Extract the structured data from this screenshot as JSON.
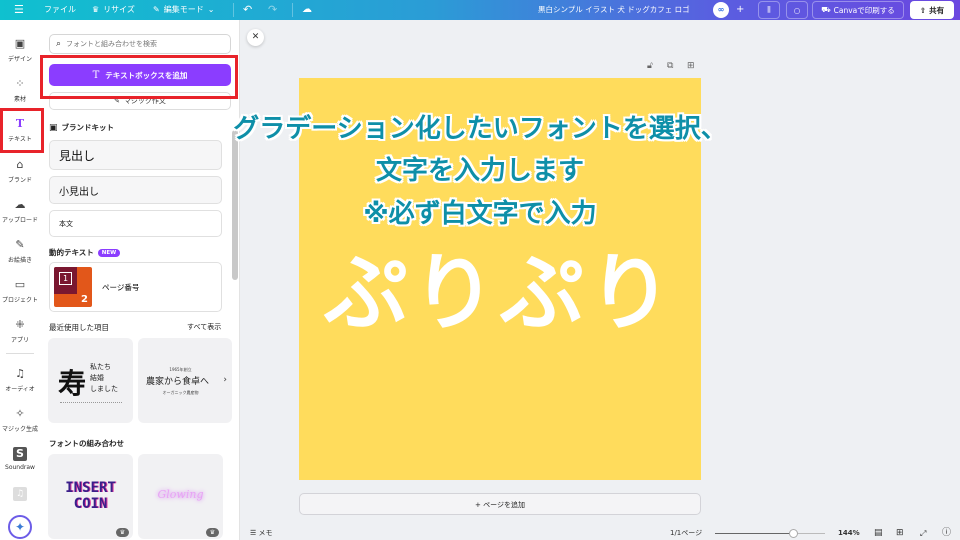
{
  "topbar": {
    "menu_icon": "hamburger-icon",
    "file": "ファイル",
    "resize": "リサイズ",
    "edit_mode": "編集モード",
    "undo_icon": "undo-icon",
    "redo_icon": "redo-icon",
    "cloud_icon": "cloud-saved-icon",
    "doc_title": "黒白シンプル イラスト 犬 ドッグカフェ ロゴ",
    "add": "+",
    "print": "Canvaで印刷する",
    "share": "共有"
  },
  "rail": {
    "items": [
      {
        "label": "デザイン",
        "icon": "▣"
      },
      {
        "label": "素材",
        "icon": "⁘"
      },
      {
        "label": "テキスト",
        "icon": "T"
      },
      {
        "label": "ブランド",
        "icon": "⌂"
      },
      {
        "label": "アップロード",
        "icon": "☁"
      },
      {
        "label": "お絵描き",
        "icon": "✎"
      },
      {
        "label": "プロジェクト",
        "icon": "▭"
      },
      {
        "label": "アプリ",
        "icon": "⁜"
      },
      {
        "label": "オーディオ",
        "icon": "♫"
      },
      {
        "label": "マジック生成",
        "icon": "✧"
      },
      {
        "label": "Soundraw",
        "icon": "S"
      }
    ]
  },
  "panel": {
    "search_placeholder": "フォントと組み合わせを検索",
    "add_textbox": "テキストボックスを追加",
    "magic_write": "マジック作文",
    "brand_kit": "ブランドキット",
    "heading": "見出し",
    "subheading": "小見出し",
    "body": "本文",
    "dynamic_text": "動的テキスト",
    "new_badge": "NEW",
    "page_number": "ページ番号",
    "thumb_num1": "1",
    "thumb_num2": "2",
    "recent": "最近使用した項目",
    "see_all": "すべて表示",
    "recent_items": [
      {
        "big": "寿",
        "lines": "私たち\n結婚\nしました"
      },
      {
        "small_top": "1965年創立",
        "big": "農家から食卓へ",
        "small_bottom": "オーガニック農産物"
      }
    ],
    "font_combos": "フォントの組み合わせ",
    "combo_items": [
      {
        "text1": "INSERT",
        "text2": "COIN"
      },
      {
        "text1": "Glowing"
      }
    ]
  },
  "canvas": {
    "instruction_line1": "グラデーション化したいフォントを選択、",
    "instruction_line2": "文字を入力します",
    "instruction_line3": "※必ず白文字で入力",
    "page_text": "ぷりぷり",
    "add_page": "+ ページを追加",
    "page_color": "#ffdc5c"
  },
  "bottom": {
    "notes": "メモ",
    "page_indicator": "1/1ページ",
    "zoom": "144%",
    "zoom_fraction": 0.72
  },
  "colors": {
    "accent": "#8b3dff",
    "highlight": "#e8232a",
    "instruction": "#0e8fa8"
  }
}
